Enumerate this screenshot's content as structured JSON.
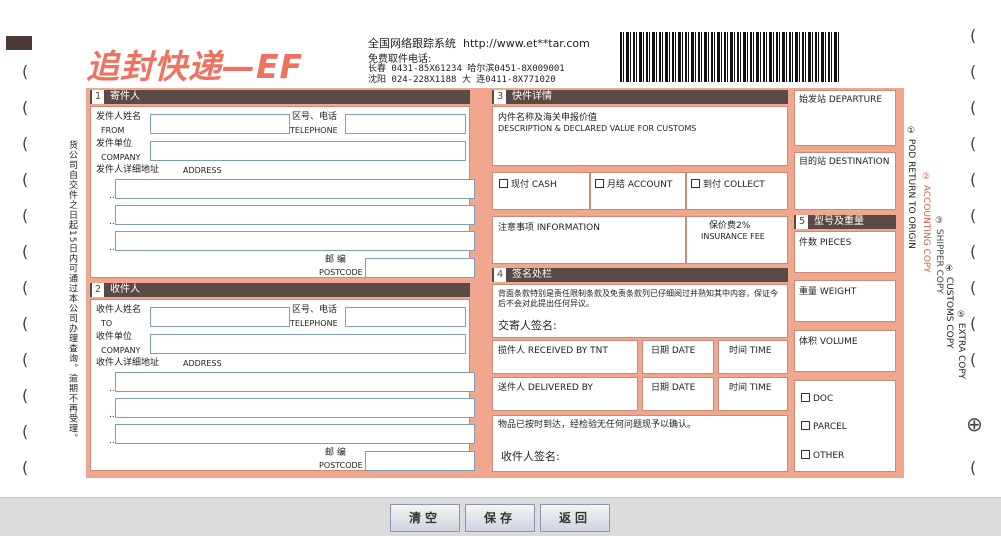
{
  "header": {
    "logo": "追封快递—EF",
    "system_title": "全国网络跟踪系统",
    "url": "http://www.et**tar.com",
    "hotline_label": "免费取件电话:",
    "hotline_1": "长春 0431-85X61234  哈尔滨0451-8X009001",
    "hotline_2": "沈阳 024-228X1188   大 连0411-8X771020"
  },
  "side_notice": "货公司自交件之日起15日内可通过本公司办理查询。逾期不再受理。",
  "right_copies": [
    "① POD RETURN TO ORIGIN",
    "② ACCOUNTING COPY",
    "③ SHIPPER COPY",
    "④ CUSTOMS COPY",
    "⑤ EXTRA COPY"
  ],
  "sender": {
    "section_num": "1",
    "section_title": "寄件人",
    "name_label": "发件人姓名",
    "name_label_en": "FROM",
    "phone_label": "区号、电话",
    "phone_label_en": "TELEPHONE",
    "company_label": "发件单位",
    "company_label_en": "COMPANY",
    "address_label": "发件人详细地址",
    "address_label_en": "ADDRESS",
    "postcode_label": "邮 编",
    "postcode_label_en": "POSTCODE"
  },
  "recipient": {
    "section_num": "2",
    "section_title": "收件人",
    "name_label": "收件人姓名",
    "name_label_en": "TO",
    "phone_label": "区号、电话",
    "phone_label_en": "TELEPHONE",
    "company_label": "收件单位",
    "company_label_en": "COMPANY",
    "address_label": "收件人详细地址",
    "address_label_en": "ADDRESS",
    "postcode_label": "邮 编",
    "postcode_label_en": "POSTCODE"
  },
  "details": {
    "section_num": "3",
    "section_title": "快件详情",
    "desc_label": "内件名称及海关申报价值",
    "desc_label_en": "DESCRIPTION & DECLARED VALUE FOR CUSTOMS",
    "pay_cash": "现付 CASH",
    "pay_account": "月结 ACCOUNT",
    "pay_collect": "到付 COLLECT",
    "info_label": "注意事项 INFORMATION",
    "insurance_label": "保价费2%",
    "insurance_label_en": "INSURANCE FEE"
  },
  "signature": {
    "section_num": "4",
    "section_title": "签名处栏",
    "terms": "背面条款特别是责任限制条款及免责条款列已仔细阅过并熟知其中内容，保证今后不会对此提出任何异议。",
    "sender_sign": "交寄人签名:",
    "received_by": "揽件人 RECEIVED BY TNT",
    "date_1": "日期 DATE",
    "time_1": "时间 TIME",
    "delivered_by": "送件人 DELIVERED BY",
    "date_2": "日期 DATE",
    "time_2": "时间 TIME",
    "confirm_text": "物品已按时到达，经检验无任何问题现予以确认。",
    "recipient_sign": "收件人签名:"
  },
  "route": {
    "departure": "始发站 DEPARTURE",
    "destination": "目的站 DESTINATION"
  },
  "type_weight": {
    "section_num": "5",
    "section_title": "型号及重量",
    "pieces": "件数 PIECES",
    "weight": "重量 WEIGHT",
    "volume": "体积 VOLUME",
    "doc": "DOC",
    "parcel": "PARCEL",
    "other": "OTHER"
  },
  "buttons": {
    "clear": "清空",
    "save": "保存",
    "back": "返回"
  }
}
